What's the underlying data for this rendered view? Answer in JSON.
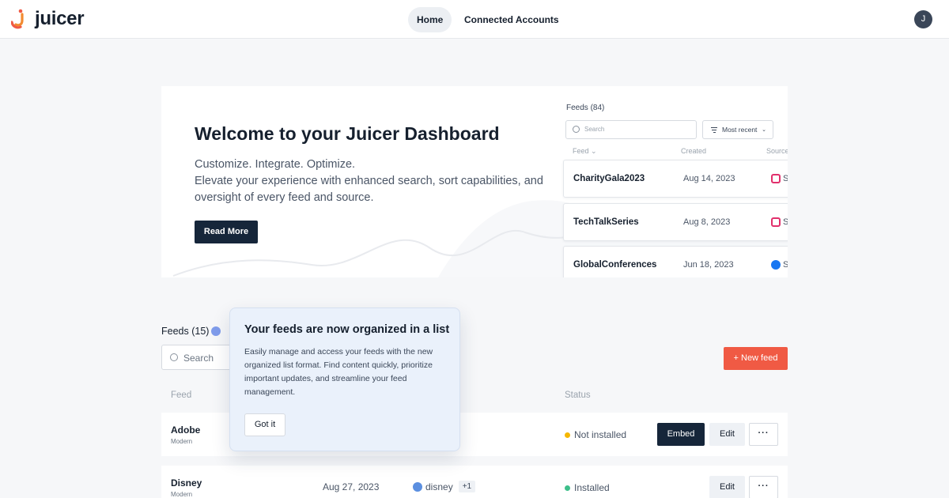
{
  "nav": {
    "logo_text": "juicer",
    "tabs": [
      {
        "label": "Home",
        "active": true
      },
      {
        "label": "Connected Accounts",
        "active": false
      }
    ],
    "avatar_initial": "J"
  },
  "hero": {
    "title": "Welcome to your Juicer Dashboard",
    "desc_line1": "Customize. Integrate. Optimize.",
    "desc_line2": "Elevate your experience with enhanced search, sort capabilities, and oversight of every feed and source.",
    "button": "Read More",
    "mini": {
      "title": "Feeds (84)",
      "search_placeholder": "Search",
      "sort_label": "Most recent",
      "col_feed": "Feed",
      "col_created": "Created",
      "col_source": "Source",
      "rows": [
        {
          "name": "CharityGala2023",
          "date": "Aug 14, 2023",
          "source": "instagram",
          "src_text": "S"
        },
        {
          "name": "TechTalkSeries",
          "date": "Aug 8, 2023",
          "source": "instagram",
          "src_text": "So"
        },
        {
          "name": "GlobalConferences",
          "date": "Jun 18, 2023",
          "source": "facebook",
          "src_text": "S"
        }
      ]
    }
  },
  "feeds": {
    "title": "Feeds (15)",
    "search_placeholder": "Search",
    "new_button": "+ New feed",
    "col_feed": "Feed",
    "col_status": "Status",
    "embed_label": "Embed",
    "edit_label": "Edit",
    "more_label": "···",
    "rows": [
      {
        "name": "Adobe",
        "type": "Modern",
        "date": "",
        "status": "Not installed",
        "status_color": "#f5b700"
      },
      {
        "name": "Disney",
        "type": "Modern",
        "date": "Aug 27, 2023",
        "source": "disney",
        "source_extra": "+1",
        "status": "Installed",
        "status_color": "#3dbf8a"
      }
    ]
  },
  "tooltip": {
    "title": "Your feeds are now organized in a list",
    "body": "Easily manage and access your feeds with the new organized list format. Find content quickly, prioritize important updates, and streamline your feed management.",
    "button": "Got it"
  },
  "colors": {
    "brand_orange": "#f05a44",
    "dark_button": "#16263a",
    "instagram": "#e1306c",
    "facebook": "#1877f2",
    "twitter": "#5b8fe0"
  }
}
